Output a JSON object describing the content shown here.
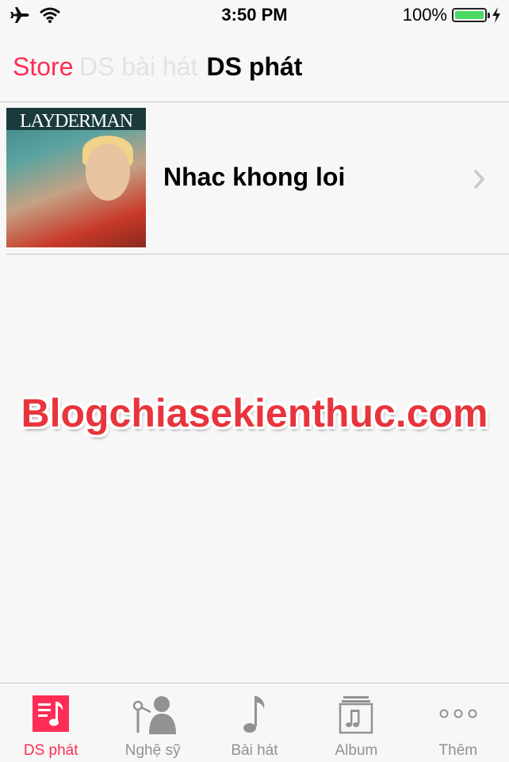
{
  "status_bar": {
    "time": "3:50 PM",
    "battery_percent": "100%",
    "battery_level": 1.0
  },
  "nav": {
    "back_label": "Store",
    "ghost_label": "DS bài hát",
    "title": "DS phát"
  },
  "playlists": [
    {
      "title": "Nhac khong loi",
      "art_text": "LAYDERMAN"
    }
  ],
  "watermark": "Blogchiasekienthuc.com",
  "tabs": [
    {
      "label": "DS phát",
      "icon": "playlist-icon",
      "active": true
    },
    {
      "label": "Nghệ sỹ",
      "icon": "artist-icon",
      "active": false
    },
    {
      "label": "Bài hát",
      "icon": "song-icon",
      "active": false
    },
    {
      "label": "Album",
      "icon": "album-icon",
      "active": false
    },
    {
      "label": "Thêm",
      "icon": "more-icon",
      "active": false
    }
  ],
  "colors": {
    "accent": "#ff2d55",
    "inactive": "#929292",
    "battery": "#4cd964",
    "watermark": "#e8343c"
  }
}
